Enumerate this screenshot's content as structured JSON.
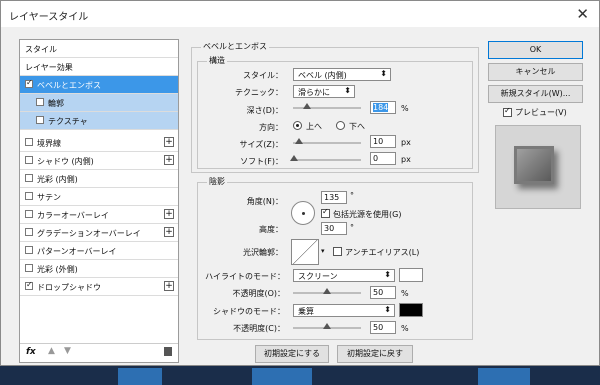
{
  "window": {
    "title": "レイヤースタイル",
    "close": "✕"
  },
  "left": {
    "items": [
      {
        "label": "スタイル"
      },
      {
        "label": "レイヤー効果"
      },
      {
        "label": "ベベルとエンボス",
        "checked": true
      },
      {
        "label": "輪郭",
        "checked": false
      },
      {
        "label": "テクスチャ",
        "checked": false
      },
      {
        "label": "境界線",
        "checked": false,
        "plus": "+"
      },
      {
        "label": "シャドウ (内側)",
        "checked": false,
        "plus": "+"
      },
      {
        "label": "光彩 (内側)",
        "checked": false
      },
      {
        "label": "サテン",
        "checked": false
      },
      {
        "label": "カラーオーバーレイ",
        "checked": false,
        "plus": "+"
      },
      {
        "label": "グラデーションオーバーレイ",
        "checked": false,
        "plus": "+"
      },
      {
        "label": "パターンオーバーレイ",
        "checked": false
      },
      {
        "label": "光彩 (外側)",
        "checked": false
      },
      {
        "label": "ドロップシャドウ",
        "checked": true,
        "plus": "+"
      }
    ],
    "fx": "fx",
    "up": "▲",
    "down": "▼"
  },
  "bevel": {
    "group": "ベベルとエンボス",
    "structure": "構造",
    "style_label": "スタイル：",
    "style_value": "ベベル (内側)",
    "technique_label": "テクニック：",
    "technique_value": "滑らかに",
    "depth_label": "深さ(D)：",
    "depth_value": "184",
    "depth_unit": "%",
    "direction_label": "方向：",
    "dir_up": "上へ",
    "dir_down": "下へ",
    "size_label": "サイズ(Z)：",
    "size_value": "10",
    "size_unit": "px",
    "soften_label": "ソフト(F)：",
    "soften_value": "0",
    "soften_unit": "px"
  },
  "shading": {
    "group": "陰影",
    "angle_label": "角度(N)：",
    "angle_value": "135",
    "deg": "°",
    "global_light": "包括光源を使用(G)",
    "altitude_label": "高度：",
    "altitude_value": "30",
    "gloss_label": "光沢輪郭：",
    "antialias": "アンチエイリアス(L)",
    "highlight_mode_label": "ハイライトのモード：",
    "highlight_mode_value": "スクリーン",
    "opacity1_label": "不透明度(O)：",
    "opacity1_value": "50",
    "shadow_mode_label": "シャドウのモード：",
    "shadow_mode_value": "乗算",
    "opacity2_label": "不透明度(C)：",
    "opacity2_value": "50",
    "pct": "%",
    "highlight_color": "#ffffff",
    "shadow_color": "#000000"
  },
  "footer": {
    "reset_default": "初期設定にする",
    "restore_default": "初期設定に戻す"
  },
  "right": {
    "ok": "OK",
    "cancel": "キャンセル",
    "new_style": "新規スタイル(W)...",
    "preview": "プレビュー(V)"
  }
}
